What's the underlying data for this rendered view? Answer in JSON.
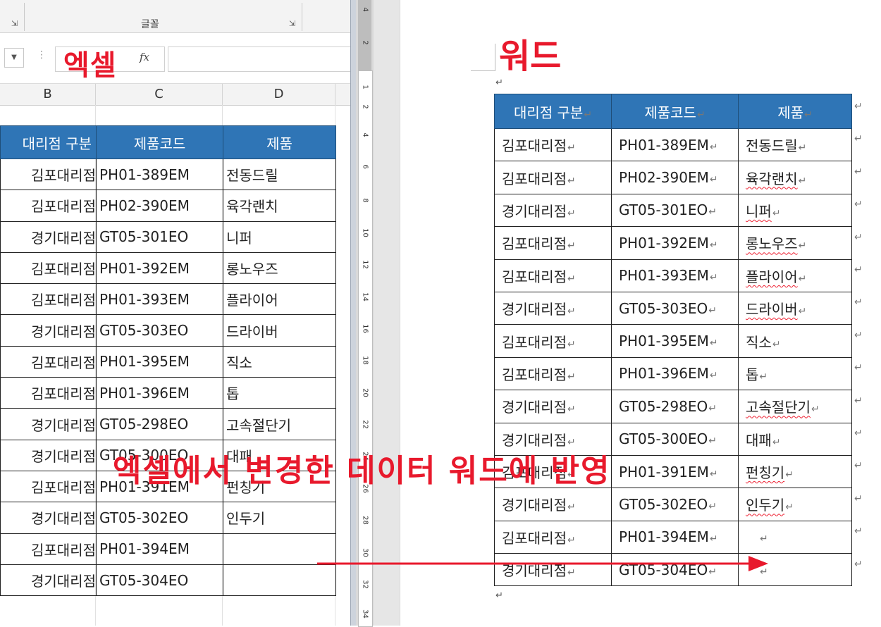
{
  "annotations": {
    "excel_label": "엑셀",
    "word_label": "워드",
    "caption": "엑셀에서 변경한 데이터 워드에 반영",
    "accent_color": "#e8192c"
  },
  "excel": {
    "ribbon": {
      "group_label": "글꼴"
    },
    "formula_bar": {
      "fx_label": "fx"
    },
    "columns": [
      "B",
      "C",
      "D"
    ],
    "header_color": "#2f75b6",
    "table": {
      "headers": [
        "대리점 구분",
        "제품코드",
        "제품"
      ],
      "rows": [
        [
          "김포대리점",
          "PH01-389EM",
          "전동드릴"
        ],
        [
          "김포대리점",
          "PH02-390EM",
          "육각랜치"
        ],
        [
          "경기대리점",
          "GT05-301EO",
          "니퍼"
        ],
        [
          "김포대리점",
          "PH01-392EM",
          "롱노우즈"
        ],
        [
          "김포대리점",
          "PH01-393EM",
          "플라이어"
        ],
        [
          "경기대리점",
          "GT05-303EO",
          "드라이버"
        ],
        [
          "김포대리점",
          "PH01-395EM",
          "직소"
        ],
        [
          "김포대리점",
          "PH01-396EM",
          "톱"
        ],
        [
          "경기대리점",
          "GT05-298EO",
          "고속절단기"
        ],
        [
          "경기대리점",
          "GT05-300EO",
          "대패"
        ],
        [
          "김포대리점",
          "PH01-391EM",
          "펀칭기"
        ],
        [
          "경기대리점",
          "GT05-302EO",
          "인두기"
        ],
        [
          "김포대리점",
          "PH01-394EM",
          ""
        ],
        [
          "경기대리점",
          "GT05-304EO",
          ""
        ]
      ]
    }
  },
  "word": {
    "ruler_numbers": [
      "4",
      "2",
      "1",
      "2",
      "4",
      "6",
      "8",
      "10",
      "12",
      "14",
      "16",
      "18",
      "20",
      "22",
      "24",
      "26",
      "28",
      "30",
      "32",
      "34"
    ],
    "paragraph_mark": "↵",
    "table": {
      "headers": [
        "대리점 구분",
        "제품코드",
        "제품"
      ],
      "rows": [
        [
          "김포대리점",
          "PH01-389EM",
          "전동드릴"
        ],
        [
          "김포대리점",
          "PH02-390EM",
          "육각랜치"
        ],
        [
          "경기대리점",
          "GT05-301EO",
          "니퍼"
        ],
        [
          "김포대리점",
          "PH01-392EM",
          "롱노우즈"
        ],
        [
          "김포대리점",
          "PH01-393EM",
          "플라이어"
        ],
        [
          "경기대리점",
          "GT05-303EO",
          "드라이버"
        ],
        [
          "김포대리점",
          "PH01-395EM",
          "직소"
        ],
        [
          "김포대리점",
          "PH01-396EM",
          "톱"
        ],
        [
          "경기대리점",
          "GT05-298EO",
          "고속절단기"
        ],
        [
          "경기대리점",
          "GT05-300EO",
          "대패"
        ],
        [
          "김포대리점",
          "PH01-391EM",
          "펀칭기"
        ],
        [
          "경기대리점",
          "GT05-302EO",
          "인두기"
        ],
        [
          "김포대리점",
          "PH01-394EM",
          ""
        ],
        [
          "경기대리점",
          "GT05-304EO",
          ""
        ]
      ]
    }
  }
}
